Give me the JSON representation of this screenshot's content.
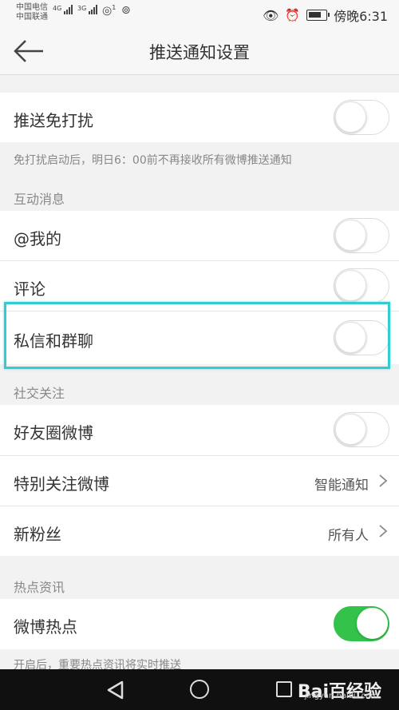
{
  "status_bar": {
    "carrier_1": "中国电信",
    "carrier_2": "中国联通",
    "net_1": "4G",
    "net_2": "3G",
    "notif_count": "1",
    "time": "傍晚6:31"
  },
  "header": {
    "title": "推送通知设置"
  },
  "dnd": {
    "label": "推送免打扰",
    "enabled": false,
    "note": "免打扰启动后，明日6：00前不再接收所有微博推送通知"
  },
  "sections": {
    "interaction": {
      "title": "互动消息",
      "items": [
        {
          "label": "@我的",
          "enabled": false
        },
        {
          "label": "评论",
          "enabled": false
        },
        {
          "label": "私信和群聊",
          "enabled": false
        }
      ]
    },
    "social": {
      "title": "社交关注",
      "friends": {
        "label": "好友圈微博",
        "enabled": false
      },
      "special": {
        "label": "特别关注微博",
        "value": "智能通知"
      },
      "fans": {
        "label": "新粉丝",
        "value": "所有人"
      }
    },
    "hot": {
      "title": "热点资讯",
      "items": [
        {
          "label": "微博热点",
          "enabled": true
        }
      ],
      "note": "开启后，重要热点资讯将实时推送"
    }
  },
  "watermark": {
    "brand": "Bai百经验",
    "url": "jingyan.baidu.com"
  },
  "colors": {
    "toggle_on": "#33c24a",
    "highlight": "#36cbd0"
  }
}
